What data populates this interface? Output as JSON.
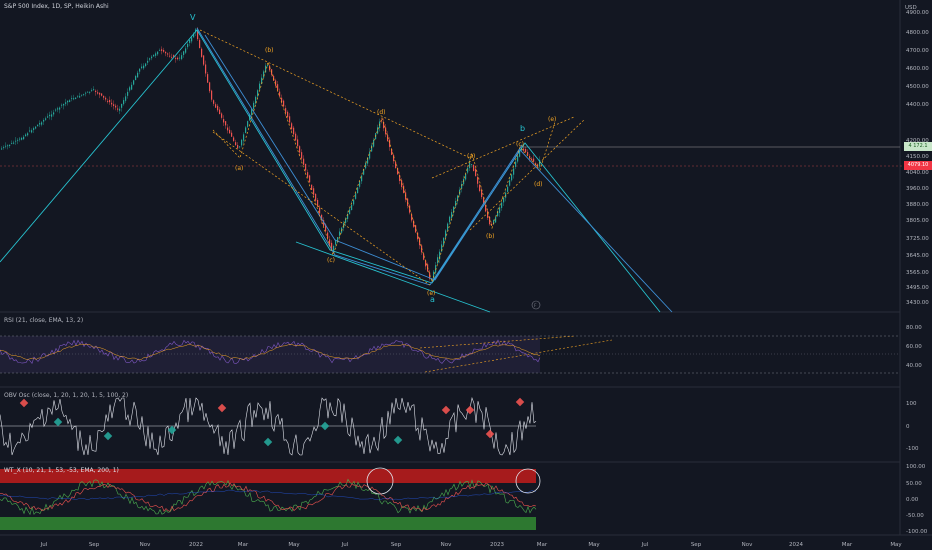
{
  "header": {
    "symbol_title": "S&P 500 Index, 1D, SP, Heikin Ashi",
    "currency": "USD"
  },
  "price_axis": {
    "labels": [
      "4900.00",
      "4800.00",
      "4700.00",
      "4600.00",
      "4500.00",
      "4400.00",
      "4200.00",
      "4150.00",
      "4040.00",
      "3960.00",
      "3880.00",
      "3805.00",
      "3725.00",
      "3645.00",
      "3565.00",
      "3495.00",
      "3430.00"
    ],
    "tag_green": "4 172.1",
    "tag_red": "4079.10"
  },
  "waves": {
    "primary_v": "V",
    "b_main": "b",
    "a_main": "a",
    "sub": [
      "(a)",
      "(b)",
      "(c)",
      "(d)",
      "(e)",
      "(a)",
      "(b)",
      "(c)",
      "(d)",
      "(e)"
    ],
    "circle_note": "F"
  },
  "rsi": {
    "label": "RSI (21, close, EMA, 13, 2)",
    "levels": [
      "80.00",
      "60.00",
      "40.00"
    ]
  },
  "obv": {
    "label": "OBV Osc (close, 1, 20, 1, 20, 1, 5, 100, 2)",
    "levels": [
      "100",
      "0",
      "-100"
    ]
  },
  "wt": {
    "label": "WT_X (10, 21, 1, 53, -53, EMA, 200, 1)",
    "levels": [
      "100.00",
      "50.00",
      "0.00",
      "-50.00",
      "-100.00"
    ]
  },
  "time_axis": {
    "labels": [
      "Jul",
      "Sep",
      "Nov",
      "2022",
      "Mar",
      "May",
      "Jul",
      "Sep",
      "Nov",
      "2023",
      "Mar",
      "May",
      "Jul",
      "Sep",
      "Nov",
      "2024",
      "Mar",
      "May"
    ]
  },
  "colors": {
    "bg": "#131722",
    "up": "#26a69a",
    "down": "#ef5350",
    "wave_blue": "#3e8fd6",
    "wave_cyan": "#27c2cf",
    "fib_orange": "#f5a623",
    "rsi_band": "#7e57c2"
  }
}
